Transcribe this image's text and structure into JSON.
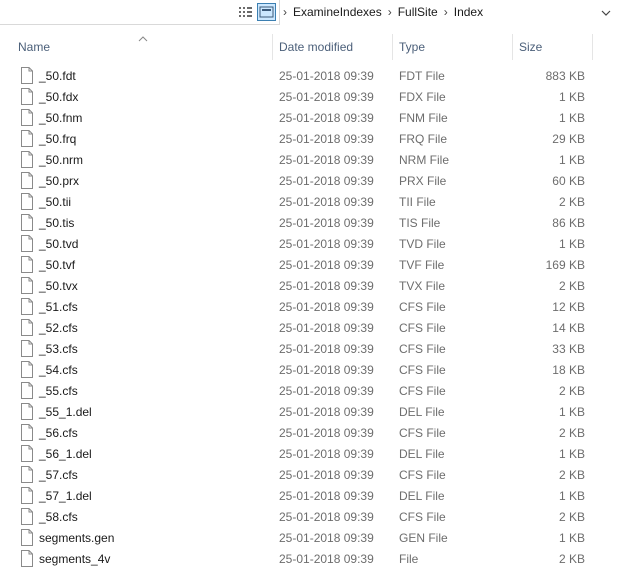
{
  "address_bar": {
    "breadcrumbs": [
      "ExamineIndexes",
      "FullSite",
      "Index"
    ]
  },
  "view_buttons": {
    "details_icon": "details-view-icon",
    "large_icons_icon": "large-icons-view-icon"
  },
  "columns": {
    "name": "Name",
    "date_modified": "Date modified",
    "type": "Type",
    "size": "Size"
  },
  "files": [
    {
      "name": "_50.fdt",
      "date": "25-01-2018 09:39",
      "type": "FDT File",
      "size": "883 KB"
    },
    {
      "name": "_50.fdx",
      "date": "25-01-2018 09:39",
      "type": "FDX File",
      "size": "1 KB"
    },
    {
      "name": "_50.fnm",
      "date": "25-01-2018 09:39",
      "type": "FNM File",
      "size": "1 KB"
    },
    {
      "name": "_50.frq",
      "date": "25-01-2018 09:39",
      "type": "FRQ File",
      "size": "29 KB"
    },
    {
      "name": "_50.nrm",
      "date": "25-01-2018 09:39",
      "type": "NRM File",
      "size": "1 KB"
    },
    {
      "name": "_50.prx",
      "date": "25-01-2018 09:39",
      "type": "PRX File",
      "size": "60 KB"
    },
    {
      "name": "_50.tii",
      "date": "25-01-2018 09:39",
      "type": "TII File",
      "size": "2 KB"
    },
    {
      "name": "_50.tis",
      "date": "25-01-2018 09:39",
      "type": "TIS File",
      "size": "86 KB"
    },
    {
      "name": "_50.tvd",
      "date": "25-01-2018 09:39",
      "type": "TVD File",
      "size": "1 KB"
    },
    {
      "name": "_50.tvf",
      "date": "25-01-2018 09:39",
      "type": "TVF File",
      "size": "169 KB"
    },
    {
      "name": "_50.tvx",
      "date": "25-01-2018 09:39",
      "type": "TVX File",
      "size": "2 KB"
    },
    {
      "name": "_51.cfs",
      "date": "25-01-2018 09:39",
      "type": "CFS File",
      "size": "12 KB"
    },
    {
      "name": "_52.cfs",
      "date": "25-01-2018 09:39",
      "type": "CFS File",
      "size": "14 KB"
    },
    {
      "name": "_53.cfs",
      "date": "25-01-2018 09:39",
      "type": "CFS File",
      "size": "33 KB"
    },
    {
      "name": "_54.cfs",
      "date": "25-01-2018 09:39",
      "type": "CFS File",
      "size": "18 KB"
    },
    {
      "name": "_55.cfs",
      "date": "25-01-2018 09:39",
      "type": "CFS File",
      "size": "2 KB"
    },
    {
      "name": "_55_1.del",
      "date": "25-01-2018 09:39",
      "type": "DEL File",
      "size": "1 KB"
    },
    {
      "name": "_56.cfs",
      "date": "25-01-2018 09:39",
      "type": "CFS File",
      "size": "2 KB"
    },
    {
      "name": "_56_1.del",
      "date": "25-01-2018 09:39",
      "type": "DEL File",
      "size": "1 KB"
    },
    {
      "name": "_57.cfs",
      "date": "25-01-2018 09:39",
      "type": "CFS File",
      "size": "2 KB"
    },
    {
      "name": "_57_1.del",
      "date": "25-01-2018 09:39",
      "type": "DEL File",
      "size": "1 KB"
    },
    {
      "name": "_58.cfs",
      "date": "25-01-2018 09:39",
      "type": "CFS File",
      "size": "2 KB"
    },
    {
      "name": "segments.gen",
      "date": "25-01-2018 09:39",
      "type": "GEN File",
      "size": "1 KB"
    },
    {
      "name": "segments_4v",
      "date": "25-01-2018 09:39",
      "type": "File",
      "size": "2 KB"
    }
  ],
  "colors": {
    "header_text": "#4c607a",
    "secondary_text": "#6d6d6d",
    "selected_view_bg": "#cce8ff",
    "selected_view_border": "#3c7fb1"
  }
}
